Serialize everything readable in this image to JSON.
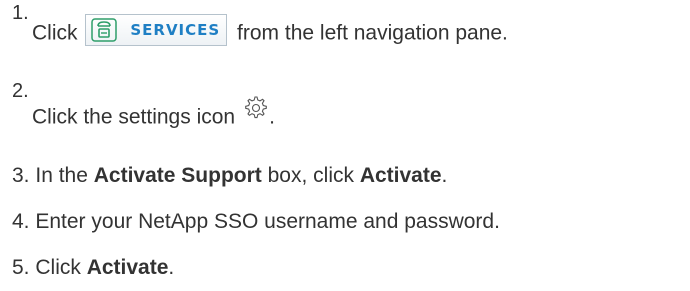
{
  "steps": [
    {
      "number": "1.",
      "pre": "Click",
      "button_label": "SERVICES",
      "post": "from the left navigation pane."
    },
    {
      "number": "2.",
      "text": "Click the settings icon",
      "post": "."
    },
    {
      "number": "3.",
      "pre": "In the",
      "bold1": "Activate Support",
      "mid": "box, click",
      "bold2": "Activate",
      "post": "."
    },
    {
      "number": "4.",
      "text": "Enter your NetApp SSO username and password."
    },
    {
      "number": "5.",
      "pre": "Click",
      "bold": "Activate",
      "post": "."
    }
  ],
  "colors": {
    "text": "#333333",
    "services_label": "#1f7fc4",
    "services_icon": "#2e9e6a"
  },
  "icons": {
    "services": "services-icon",
    "settings": "gear-icon"
  }
}
